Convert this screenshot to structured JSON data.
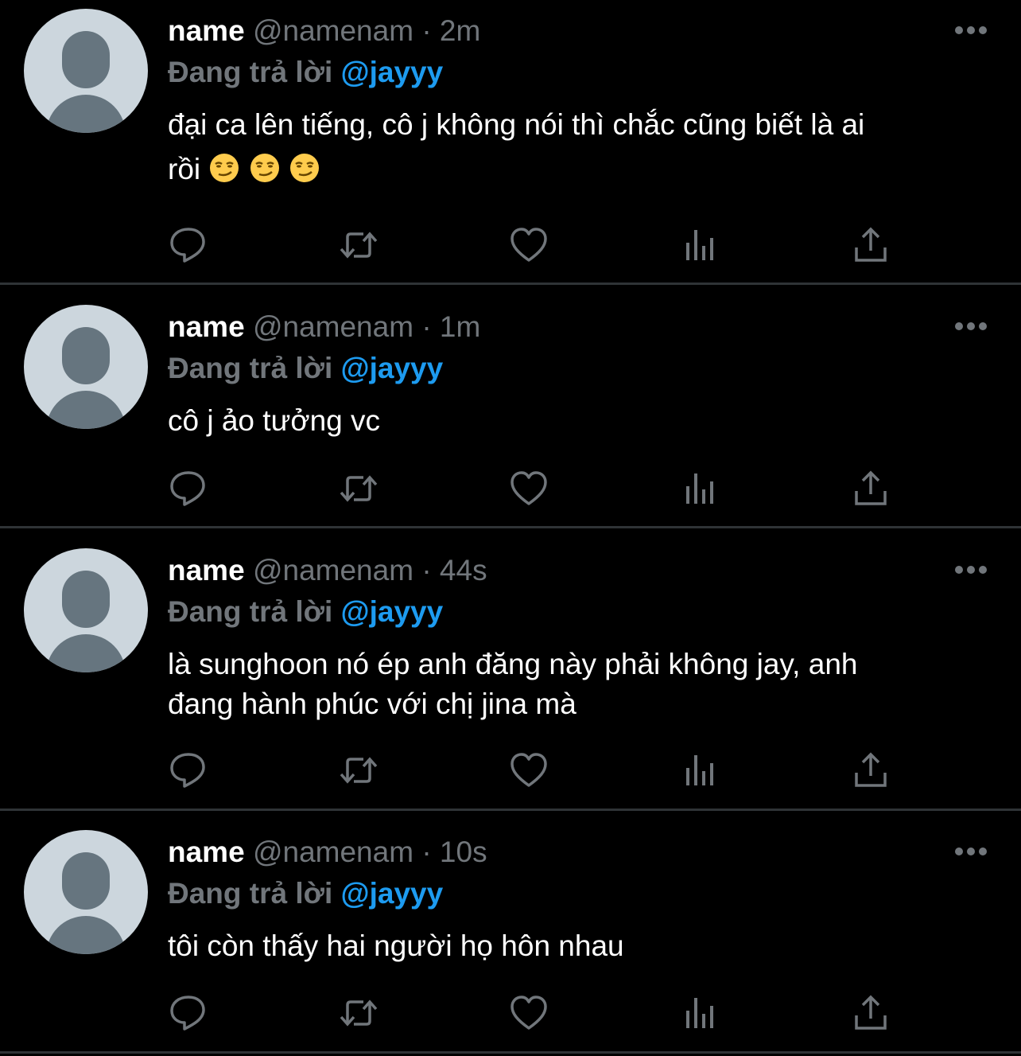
{
  "tweets": [
    {
      "name": "name",
      "handle": "@namenam",
      "separator": "·",
      "time": "2m",
      "reply_label": "Đang trả lời",
      "reply_to": "@jayyy",
      "text": "đại ca lên tiếng, cô j không nói thì chắc cũng biết là ai",
      "text_line2": "rồi",
      "emojis": [
        "smirk-emoji",
        "smirk-emoji",
        "smirk-emoji"
      ]
    },
    {
      "name": "name",
      "handle": "@namenam",
      "separator": "·",
      "time": "1m",
      "reply_label": "Đang trả lời",
      "reply_to": "@jayyy",
      "text": "cô j ảo tưởng vc"
    },
    {
      "name": "name",
      "handle": "@namenam",
      "separator": "·",
      "time": "44s",
      "reply_label": "Đang trả lời",
      "reply_to": "@jayyy",
      "text": "là sunghoon nó ép anh đăng này phải không jay, anh",
      "text_line2": "đang hành phúc với chị jina mà"
    },
    {
      "name": "name",
      "handle": "@namenam",
      "separator": "·",
      "time": "10s",
      "reply_label": "Đang trả lời",
      "reply_to": "@jayyy",
      "text": "tôi còn thấy hai người họ hôn nhau"
    }
  ],
  "icons": {
    "reply": "reply-icon",
    "retweet": "retweet-icon",
    "like": "heart-icon",
    "views": "views-icon",
    "share": "share-icon",
    "more": "more-icon"
  },
  "colors": {
    "background": "#000000",
    "text": "#ffffff",
    "muted": "#71767b",
    "accent": "#1d9bf0",
    "divider": "#2f3336",
    "avatar_bg": "#ccd6dd",
    "avatar_fg": "#66757f"
  }
}
